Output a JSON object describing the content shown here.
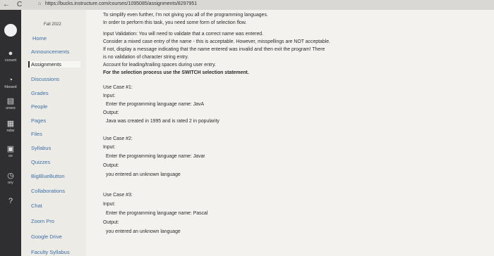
{
  "browser": {
    "back": "←",
    "reload": "C",
    "url": "https://bucks.instructure.com/courses/1095085/assignments/8297951"
  },
  "global_nav": [
    {
      "icon": "account-icon",
      "glyph": "●",
      "label": "ccount"
    },
    {
      "icon": "dashboard-icon",
      "glyph": "◔",
      "label": "hboard"
    },
    {
      "icon": "courses-icon",
      "glyph": "▤",
      "label": "urses"
    },
    {
      "icon": "calendar-icon",
      "glyph": "▦",
      "label": "ndar"
    },
    {
      "icon": "inbox-icon",
      "glyph": "▣",
      "label": "ox"
    },
    {
      "icon": "history-icon",
      "glyph": "◷",
      "label": "ory"
    },
    {
      "icon": "help-icon",
      "glyph": "?",
      "label": ""
    }
  ],
  "course_nav": {
    "term": "Fall 2022",
    "items": [
      "Home",
      "Announcements",
      "Assignments",
      "Discussions",
      "Grades",
      "People",
      "Pages",
      "Files",
      "Syllabus",
      "Quizzes",
      "BigBlueButton",
      "Collaborations",
      "Chat",
      "Zoom Pro",
      "Google Drive",
      "Faculty Syllabus"
    ],
    "active": "Assignments"
  },
  "content": {
    "intro": [
      "To simplify even further, I'm not giving you all of the programming languages.",
      "In order to perform this task, you need some form of selection flow."
    ],
    "validation": [
      "Input Validation: You will need to validate that a correct name was entered.",
      "Consider a mixed case entry of the name - this is acceptable. However, misspellings are NOT acceptable.",
      "If not, display a message indicating that the name entered was invalid and then exit the program! There",
      "is no validation of character string entry.",
      "Account for leading/trailing spaces during user entry."
    ],
    "switch_note": "For the selection process use the SWITCH selection statement.",
    "use_cases": [
      {
        "title": "Use Case #1:",
        "input_label": "Input:",
        "prompt": "Enter the programming language name: JavA",
        "output_label": "Output:",
        "output": "Java was created in 1995 and is rated 2 in popularity"
      },
      {
        "title": "Use Case #2:",
        "input_label": "Input:",
        "prompt": "Enter the programming language name: Javar",
        "output_label": "Output:",
        "output": "you entered an unknown language"
      },
      {
        "title": "Use Case #3:",
        "input_label": "Input:",
        "prompt": "Enter the programming language name: Pascal",
        "output_label": "Output:",
        "output": "you entered an unknown language"
      }
    ]
  }
}
